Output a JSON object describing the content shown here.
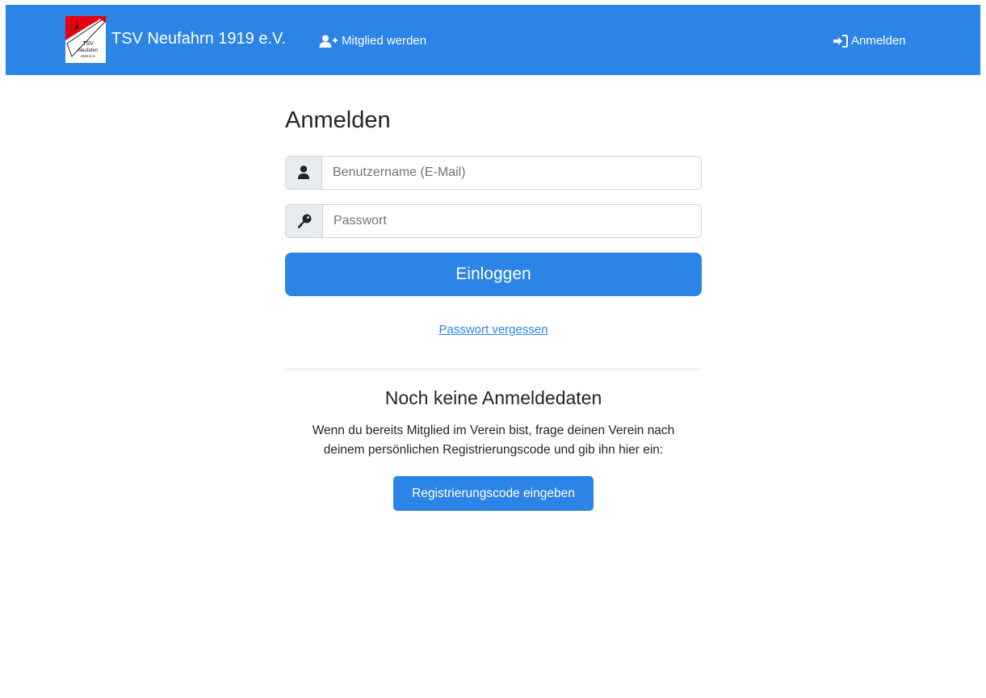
{
  "navbar": {
    "brand": "TSV Neufahrn 1919 e.V.",
    "logo": {
      "line1": "TSV",
      "line2": "Neufahrn",
      "line3": "1919 e.V.",
      "icon": "club-logo"
    },
    "member_link": {
      "label": "Mitglied werden",
      "icon": "user-plus-icon"
    },
    "login_link": {
      "label": "Anmelden",
      "icon": "sign-in-icon"
    },
    "background": "#2b84e6"
  },
  "login": {
    "title": "Anmelden",
    "username": {
      "placeholder": "Benutzername (E-Mail)",
      "value": "",
      "icon": "user-icon"
    },
    "password": {
      "placeholder": "Passwort",
      "value": "",
      "icon": "key-icon"
    },
    "submit_label": "Einloggen",
    "forgot_label": "Passwort vergessen"
  },
  "register": {
    "title": "Noch keine Anmeldedaten",
    "text_line1": "Wenn du bereits Mitglied im Verein bist, frage deinen Verein nach",
    "text_line2": "deinem persönlichen Registrierungscode und gib ihn hier ein:",
    "button_label": "Registrierungscode eingeben"
  },
  "colors": {
    "accent": "#2b84e6",
    "addon_bg": "#e9ecef",
    "border": "#ced4da",
    "logo_red": "#e3000f"
  }
}
